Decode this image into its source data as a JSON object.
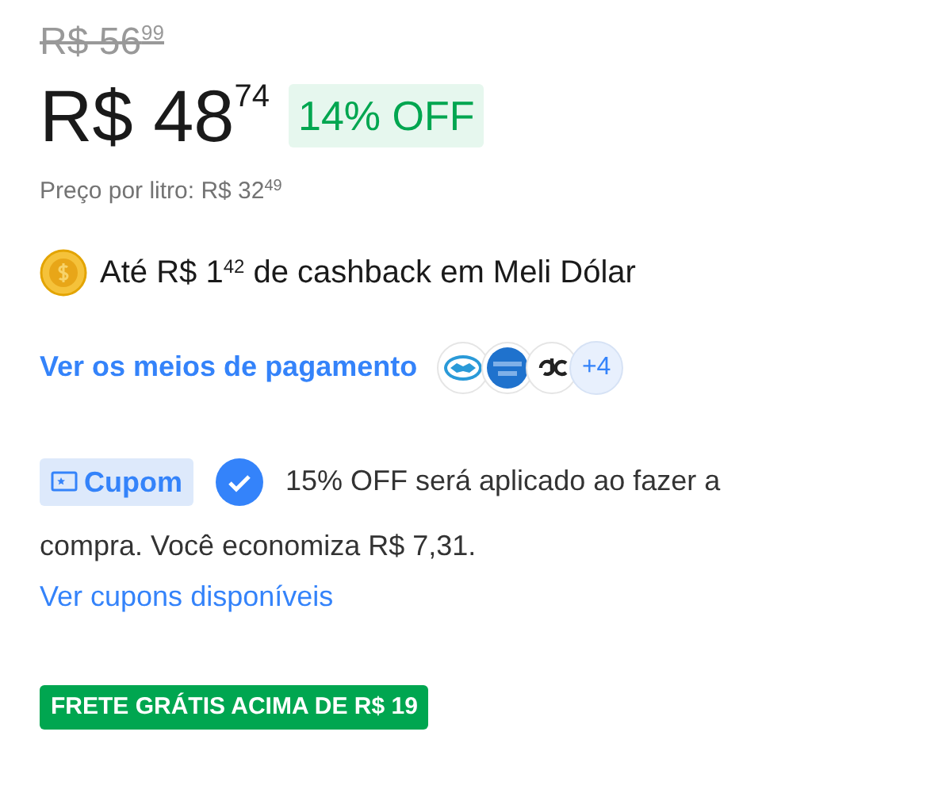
{
  "previous_price": "R$ 56$^{99}$",
  "price": "R$ 48$^{74}$",
  "discount_badge": "14% OFF",
  "price_per_liter": "Preço por litro: R$ 32$^{49}$",
  "cashback": "Até R$ 1$^{42}$ de cashback em Meli Dólar",
  "payment": {
    "link": "Ver os meios de pagamento",
    "methods": [
      {
        "kind": "handshake"
      },
      {
        "kind": "card"
      },
      {
        "kind": "elo"
      }
    ],
    "more": "+4"
  },
  "coupon": {
    "label": "Cupom",
    "applied": true,
    "message_lines": [
      "15% OFF será aplicado ao fazer a",
      "compra. Você economiza R$ 7,31."
    ],
    "link": "Ver cupons disponíveis"
  },
  "shipping_tag": "FRETE GRÁTIS ACIMA DE R$ 19"
}
